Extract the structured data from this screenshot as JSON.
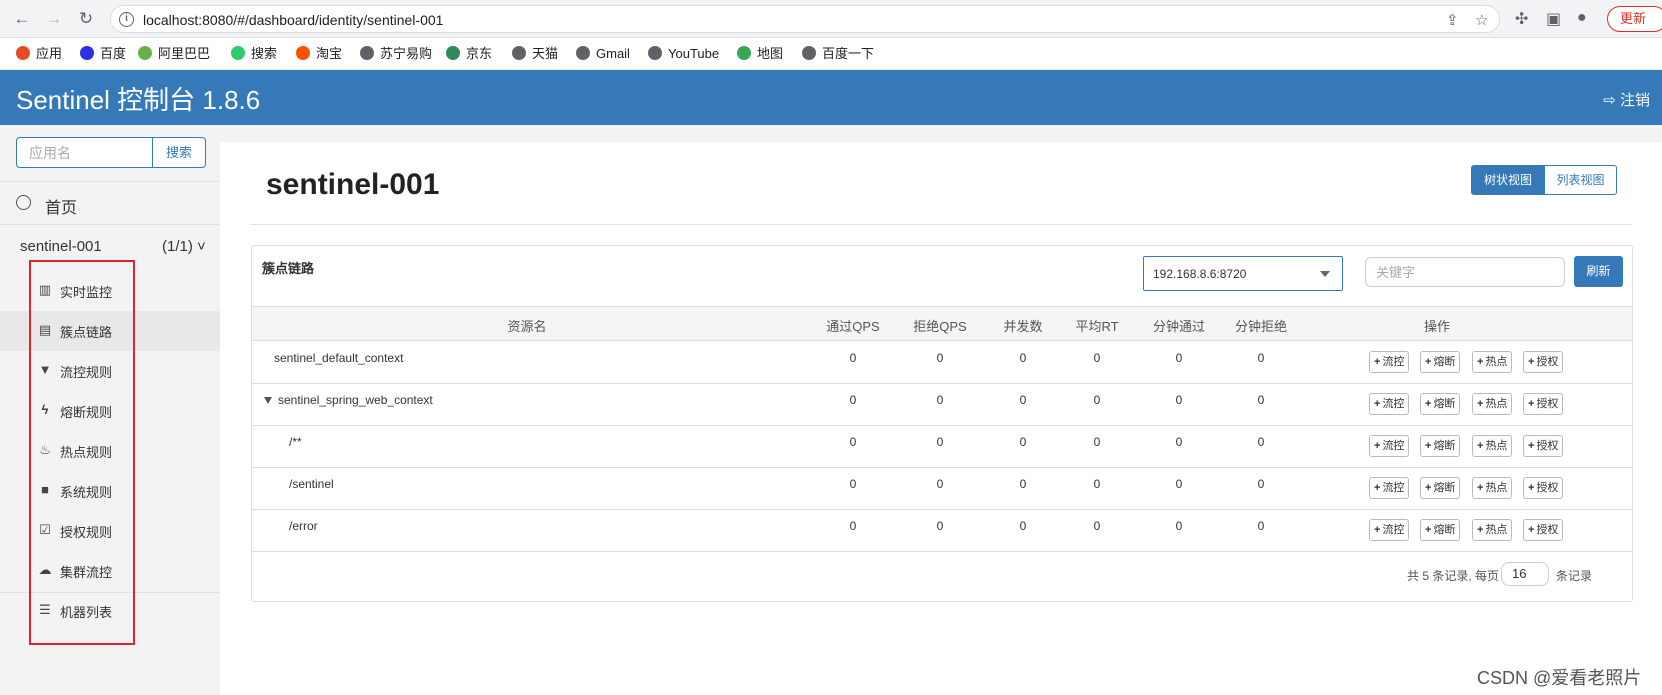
{
  "browser": {
    "url": "localhost:8080/#/dashboard/identity/sentinel-001",
    "update_label": "更新",
    "bookmarks": [
      {
        "label": "应用",
        "color": "#e34c26"
      },
      {
        "label": "百度",
        "color": "#2932e1"
      },
      {
        "label": "阿里巴巴",
        "color": "#6ab04c"
      },
      {
        "label": "搜索",
        "color": "#2ecc71"
      },
      {
        "label": "淘宝",
        "color": "#ff5000"
      },
      {
        "label": "苏宁易购",
        "color": "#5f6368"
      },
      {
        "label": "京东",
        "color": "#2e8b57"
      },
      {
        "label": "天猫",
        "color": "#5f6368"
      },
      {
        "label": "Gmail",
        "color": "#5f6368"
      },
      {
        "label": "YouTube",
        "color": "#5f6368"
      },
      {
        "label": "地图",
        "color": "#34a853"
      },
      {
        "label": "百度一下",
        "color": "#5f6368"
      }
    ]
  },
  "header": {
    "title": "Sentinel 控制台 1.8.6",
    "logout": "注销",
    "color": "#3579b8"
  },
  "sidebar": {
    "search_placeholder": "应用名",
    "search_button": "搜索",
    "home": "首页",
    "app_name": "sentinel-001",
    "app_count": "(1/1)",
    "menu": [
      {
        "label": "实时监控",
        "icon": "bar-chart-icon"
      },
      {
        "label": "簇点链路",
        "icon": "list-icon",
        "active": true
      },
      {
        "label": "流控规则",
        "icon": "filter-icon"
      },
      {
        "label": "熔断规则",
        "icon": "bolt-icon"
      },
      {
        "label": "热点规则",
        "icon": "fire-icon"
      },
      {
        "label": "系统规则",
        "icon": "lock-icon"
      },
      {
        "label": "授权规则",
        "icon": "check-square-icon"
      },
      {
        "label": "集群流控",
        "icon": "cloud-icon"
      },
      {
        "label": "机器列表",
        "icon": "th-list-icon"
      }
    ]
  },
  "main": {
    "page_title": "sentinel-001",
    "view_tree": "树状视图",
    "view_list": "列表视图",
    "panel_title": "簇点链路",
    "machine": "192.168.8.6:8720",
    "keyword_placeholder": "关键字",
    "refresh": "刷新",
    "columns": [
      "资源名",
      "通过QPS",
      "拒绝QPS",
      "并发数",
      "平均RT",
      "分钟通过",
      "分钟拒绝",
      "操作"
    ],
    "op_labels": [
      "流控",
      "熔断",
      "热点",
      "授权"
    ],
    "rows": [
      {
        "name": "sentinel_default_context",
        "values": [
          "0",
          "0",
          "0",
          "0",
          "0",
          "0"
        ],
        "expandable": false
      },
      {
        "name": "sentinel_spring_web_context",
        "values": [
          "0",
          "0",
          "0",
          "0",
          "0",
          "0"
        ],
        "expandable": true
      },
      {
        "name": "/**",
        "values": [
          "0",
          "0",
          "0",
          "0",
          "0",
          "0"
        ],
        "expandable": false
      },
      {
        "name": "/sentinel",
        "values": [
          "0",
          "0",
          "0",
          "0",
          "0",
          "0"
        ],
        "expandable": false
      },
      {
        "name": "/error",
        "values": [
          "0",
          "0",
          "0",
          "0",
          "0",
          "0"
        ],
        "expandable": false
      }
    ],
    "pager_prefix": "共 5 条记录, 每页",
    "page_size": "16",
    "pager_suffix": "条记录"
  },
  "watermark": "CSDN @爱看老照片"
}
